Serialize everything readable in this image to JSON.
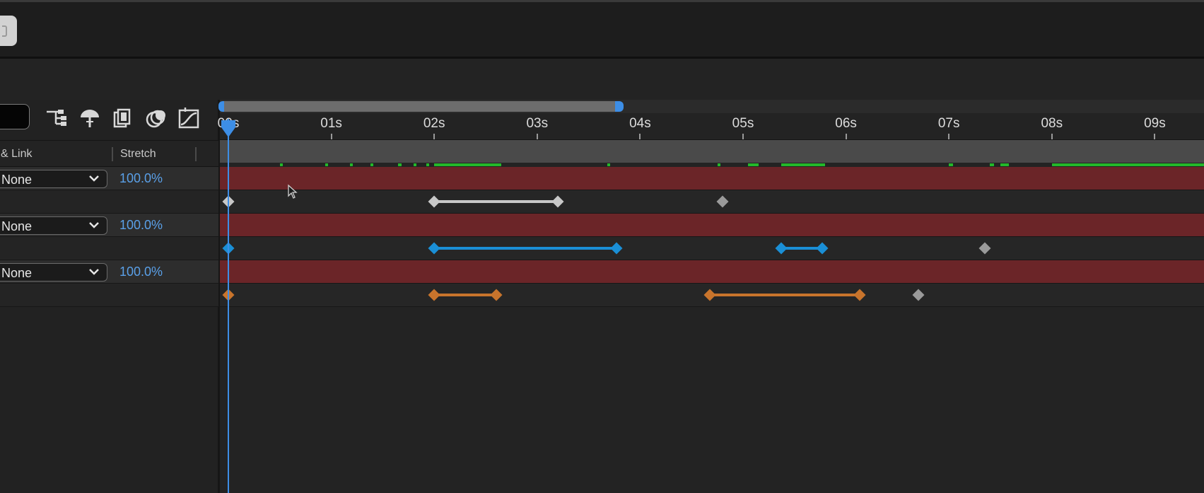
{
  "header": {
    "corner_widget_icon": "panel-menu-icon"
  },
  "toolbar": {
    "search_value": "",
    "icons": [
      "composition-flowchart-icon",
      "draft-3d-icon",
      "frame-blending-icon",
      "motion-blur-icon",
      "graph-editor-icon"
    ]
  },
  "columns": {
    "parent_link": "& Link",
    "stretch": "Stretch"
  },
  "layers": [
    {
      "parent": "None",
      "stretch": "100.0%",
      "keyframe_color": "#c8c8c8"
    },
    {
      "parent": "None",
      "stretch": "100.0%",
      "keyframe_color": "#1a8fd6"
    },
    {
      "parent": "None",
      "stretch": "100.0%",
      "keyframe_color": "#c8742c"
    }
  ],
  "ruler": {
    "labels": [
      "00s",
      "01s",
      "02s",
      "03s",
      "04s",
      "05s",
      "06s",
      "07s",
      "08s",
      "09s"
    ]
  },
  "timeline": {
    "current_time_s": 0,
    "work_area_s": [
      0,
      3.8
    ],
    "layer_bar_color": "#6b2528",
    "keyframes": [
      {
        "color": "#c8c8c8",
        "spans_s": [
          [
            2.0,
            3.2
          ]
        ],
        "singles_s": [
          0,
          4.8
        ]
      },
      {
        "color": "#1a8fd6",
        "spans_s": [
          [
            2.0,
            3.77
          ],
          [
            5.37,
            5.77
          ]
        ],
        "singles_s": [
          0,
          7.35
        ]
      },
      {
        "color": "#c8742c",
        "spans_s": [
          [
            2.0,
            2.6
          ],
          [
            4.68,
            6.13
          ]
        ],
        "singles_s": [
          0,
          6.7
        ]
      }
    ],
    "cache_segments_s": [
      [
        0.5,
        0.53
      ],
      [
        0.94,
        0.97
      ],
      [
        1.18,
        1.21
      ],
      [
        1.38,
        1.41
      ],
      [
        1.65,
        1.68
      ],
      [
        1.8,
        1.83
      ],
      [
        1.92,
        1.95
      ],
      [
        2.0,
        2.65
      ],
      [
        3.68,
        3.71
      ],
      [
        4.75,
        4.78
      ],
      [
        5.05,
        5.15
      ],
      [
        5.37,
        5.8
      ],
      [
        7.0,
        7.04
      ],
      [
        7.4,
        7.44
      ],
      [
        7.5,
        7.58
      ],
      [
        8.0,
        9.9
      ]
    ],
    "colors": {
      "accent": "#3d8ee6",
      "cache": "#23b82a"
    }
  }
}
